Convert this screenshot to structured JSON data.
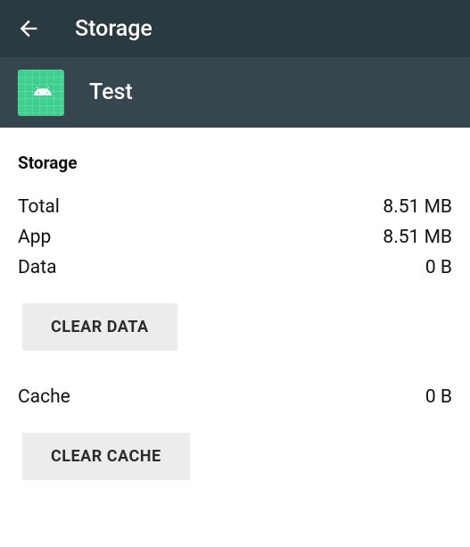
{
  "header": {
    "title": "Storage"
  },
  "app": {
    "name": "Test"
  },
  "storage": {
    "section_label": "Storage",
    "total_label": "Total",
    "total_value": "8.51 MB",
    "app_label": "App",
    "app_value": "8.51 MB",
    "data_label": "Data",
    "data_value": "0 B",
    "clear_data_label": "CLEAR DATA",
    "cache_label": "Cache",
    "cache_value": "0 B",
    "clear_cache_label": "CLEAR CACHE"
  }
}
